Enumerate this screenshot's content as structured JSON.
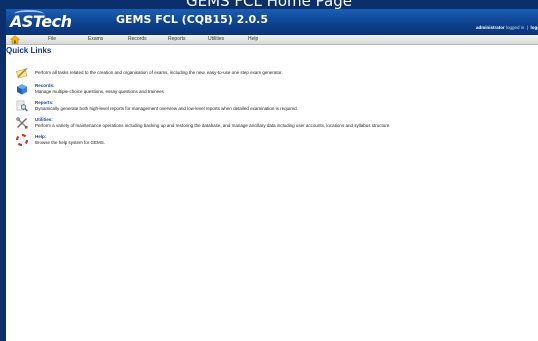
{
  "slide": {
    "title": "GEMS FCL Home Page"
  },
  "header": {
    "logo_text": "ASTech",
    "app_title": "GEMS FCL (CQB15) 2.0.5",
    "user": {
      "name": "administrator",
      "status": "logged in",
      "separator": "|",
      "logout_label": "logo"
    }
  },
  "menu": {
    "home_icon": "home-icon",
    "items": [
      {
        "label": "File"
      },
      {
        "label": "Exams"
      },
      {
        "label": "Records"
      },
      {
        "label": "Reports"
      },
      {
        "label": "Utilities"
      },
      {
        "label": "Help"
      }
    ]
  },
  "quick_links": {
    "title": "Quick Links",
    "items": [
      {
        "icon": "exam-pencil-icon",
        "heading": "",
        "description": "Perform all tasks related to the creation and organisation of exams, including the new, easy-to-use one step exam generator."
      },
      {
        "icon": "records-cube-icon",
        "heading": "Records:",
        "description": "Manage multiple-choice questions, essay questions and trainees"
      },
      {
        "icon": "reports-magnifier-icon",
        "heading": "Reports:",
        "description": "Dynamically generate both high-level reports for management overview and low-level reports when detailed examination is required."
      },
      {
        "icon": "utilities-tools-icon",
        "heading": "Utilities:",
        "description": "Perform a variety of maintenance operations including backing up and restoring the database, and manage ancillary data including user accounts, locations and syllabus structure."
      },
      {
        "icon": "help-lifebuoy-icon",
        "heading": "Help:",
        "description": "Browse the help system for GEMS."
      }
    ]
  },
  "colors": {
    "slide_background": "#0b2f6b",
    "header_blue": "#0d3f8c",
    "link_blue": "#1f3fa5",
    "title_blue": "#15399b"
  }
}
